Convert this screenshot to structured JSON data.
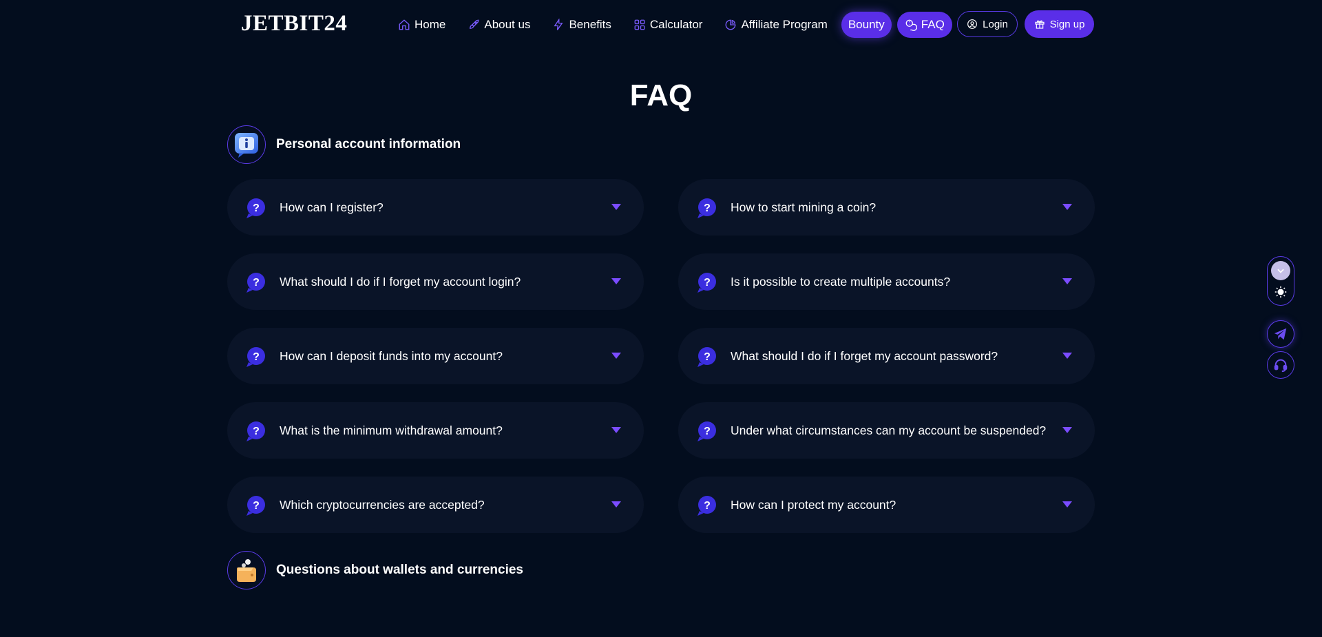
{
  "brand": {
    "logo_text": "JETBIT24"
  },
  "nav": {
    "items": [
      {
        "label": "Home",
        "icon": "home-icon"
      },
      {
        "label": "About us",
        "icon": "rocket-icon"
      },
      {
        "label": "Benefits",
        "icon": "lightning-icon"
      },
      {
        "label": "Calculator",
        "icon": "grid-icon"
      },
      {
        "label": "Affiliate Program",
        "icon": "pie-chart-icon"
      }
    ],
    "bounty_label": "Bounty",
    "faq_label": "FAQ"
  },
  "auth": {
    "login_label": "Login",
    "signup_label": "Sign up"
  },
  "page": {
    "title": "FAQ"
  },
  "sections": [
    {
      "title": "Personal account information",
      "icon": "info-chat-icon"
    },
    {
      "title": "Questions about wallets and currencies",
      "icon": "wallet-icon"
    }
  ],
  "faq": {
    "left": [
      "How can I register?",
      "What should I do if I forget my account login?",
      "How can I deposit funds into my account?",
      "What is the minimum withdrawal amount?",
      "Which cryptocurrencies are accepted?"
    ],
    "right": [
      "How to start mining a coin?",
      "Is it possible to create multiple accounts?",
      "What should I do if I forget my account password?",
      "Under what circumstances can my account be suspended?",
      "How can I protect my account?"
    ]
  },
  "side_controls": [
    "theme-toggle",
    "telegram-icon",
    "headset-icon"
  ],
  "colors": {
    "background": "#030d1e",
    "accent": "#5a2ee8",
    "card": "#0a1428",
    "arrow": "#7b4cff"
  }
}
